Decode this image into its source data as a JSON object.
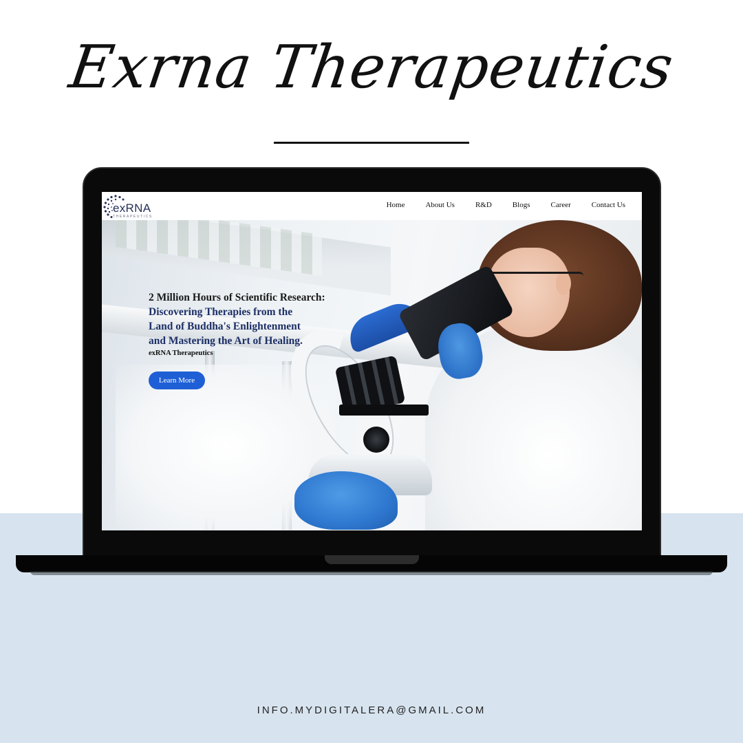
{
  "page": {
    "title": "Exrna Therapeutics",
    "contact_email": "INFO.MYDIGITALERA@GMAIL.COM",
    "colors": {
      "background_top": "#ffffff",
      "background_bottom": "#d7e4ef",
      "accent_blue": "#1f5fd6",
      "heading_navy": "#1d2f66"
    }
  },
  "website": {
    "logo": {
      "text": "exRNA",
      "subtext": "THERAPEUTICS"
    },
    "nav": {
      "items": [
        {
          "label": "Home"
        },
        {
          "label": "About Us"
        },
        {
          "label": "R&D"
        },
        {
          "label": "Blogs"
        },
        {
          "label": "Career"
        },
        {
          "label": "Contact Us"
        }
      ]
    },
    "hero": {
      "headline": "2 Million Hours of Scientific Research:",
      "subheadline_lines": [
        "Discovering Therapies from the",
        "Land of Buddha's Enlightenment",
        "and Mastering the Art of Healing."
      ],
      "brand": "exRNA Therapeutics",
      "cta_label": "Learn More"
    }
  }
}
